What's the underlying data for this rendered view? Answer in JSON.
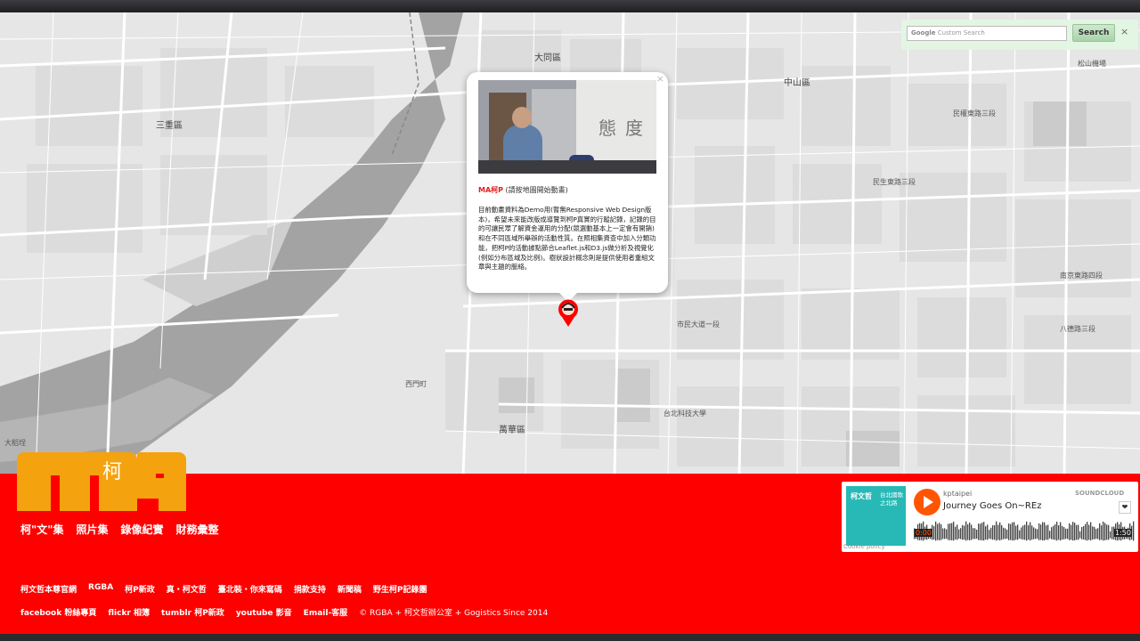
{
  "search": {
    "placeholder": "Custom Search",
    "brand": "Google",
    "button_label": "Search",
    "close_label": "×"
  },
  "map": {
    "districts": [
      "大同區",
      "中山區",
      "三重區",
      "萬華區"
    ],
    "labels": [
      "松山機場",
      "西門町",
      "民生東路三段",
      "民權東路三段",
      "南京東路四段",
      "八德路三段",
      "市民大道一段",
      "台北科技大學",
      "大稻埕"
    ],
    "colors": {
      "background": "#e9e9e9",
      "road": "#ffffff",
      "river": "#9c9c9c",
      "block": "#d6d6d6"
    }
  },
  "popup": {
    "close_label": "×",
    "photo_sign": "態度",
    "title_brand": "MA柯P",
    "title_note": " (請按地圖開始動畫)",
    "body": "目前動畫資料為Demo用(暫無Responsive Web Design版本)，希望未來能改版成導覽到柯P真實的行蹤記錄，記錄的目的可讓民眾了解資金運用的分配(競選動基本上一定會有開銷)和在不同區域所舉辦的活動性質。在照相集資查中加入分類功能，把柯P的活動據點節合Leaflet.js和D3.js做分析及視覺化(例如分布區域及比例)。樹狀設計概念則是提供使用者重組文章與主題的脈絡。"
  },
  "footer": {
    "logo_char": "柯",
    "main_nav": [
      "柯\"文\"集",
      "照片集",
      "錄像紀實",
      "財務彙整"
    ],
    "links_row1": [
      "柯文哲本尊官網",
      "RGBA",
      "柯P新政",
      "真・柯文哲",
      "臺北裝・你來寫碼",
      "捐款支持",
      "新聞稿",
      "野生柯P記錄團"
    ],
    "links_row2": [
      "facebook 粉絲專頁",
      "flickr 相簿",
      "tumblr 柯P新政",
      "youtube 影音",
      "Email-客服"
    ],
    "copyright": "© RGBA + 柯文哲辦公室 + Gogistics Since 2014",
    "colors": {
      "footer": "#fe0000",
      "logo": "#f5a20f"
    }
  },
  "soundcloud": {
    "user": "kptaipei",
    "track": "Journey Goes On~REz",
    "brand": "SOUNDCLOUD",
    "time_start": "0:00",
    "time_end": "1:50",
    "cookie": "Cookie policy",
    "art_title": "柯文哲",
    "art_subtitle": "台北國歌之北路",
    "heart_icon": "heart-icon",
    "accent": "#ff5500"
  }
}
